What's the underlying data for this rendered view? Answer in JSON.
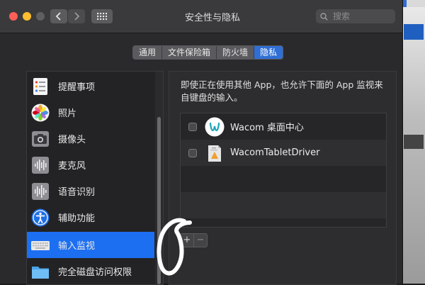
{
  "window": {
    "title": "安全性与隐私",
    "search_placeholder": "搜索"
  },
  "tabs": [
    {
      "label": "通用",
      "active": false
    },
    {
      "label": "文件保险箱",
      "active": false
    },
    {
      "label": "防火墙",
      "active": false
    },
    {
      "label": "隐私",
      "active": true
    }
  ],
  "sidebar": {
    "items": [
      {
        "label": "提醒事项",
        "icon": "reminders-icon",
        "selected": false
      },
      {
        "label": "照片",
        "icon": "photos-icon",
        "selected": false
      },
      {
        "label": "摄像头",
        "icon": "camera-icon",
        "selected": false
      },
      {
        "label": "麦克风",
        "icon": "microphone-icon",
        "selected": false
      },
      {
        "label": "语音识别",
        "icon": "speech-recognition-icon",
        "selected": false
      },
      {
        "label": "辅助功能",
        "icon": "accessibility-icon",
        "selected": false
      },
      {
        "label": "输入监视",
        "icon": "keyboard-icon",
        "selected": true
      },
      {
        "label": "完全磁盘访问权限",
        "icon": "folder-icon",
        "selected": false
      }
    ]
  },
  "panel": {
    "description": "即使正在使用其他 App，也允许下面的 App 监视来自键盘的输入。",
    "apps": [
      {
        "name": "Wacom 桌面中心",
        "icon": "wacom-icon",
        "checked": false
      },
      {
        "name": "WacomTabletDriver",
        "icon": "tablet-driver-icon",
        "checked": false
      }
    ],
    "add_label": "+",
    "remove_label": "−"
  },
  "colors": {
    "accent": "#2f6fd6",
    "selection": "#1d6ff2"
  }
}
